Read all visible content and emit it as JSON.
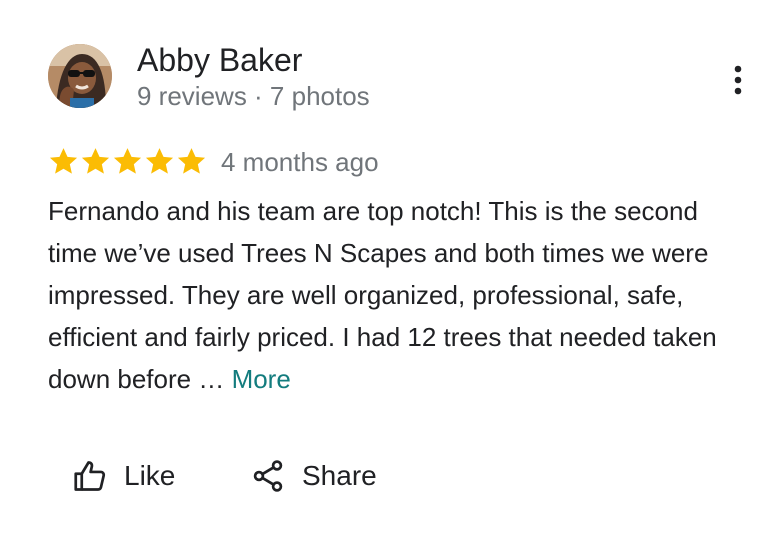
{
  "review": {
    "author": {
      "name": "Abby Baker",
      "meta": "9 reviews · 7 photos"
    },
    "rating": 5,
    "rating_max": 5,
    "time": "4 months ago",
    "text": "Fernando and his team are top notch! This is the second time we’ve used Trees N Scapes and both times we were impressed. They are well organized, professional, safe, efficient and fairly priced. I had 12 trees that needed taken down before … ",
    "more_label": "More"
  },
  "actions": {
    "like_label": "Like",
    "share_label": "Share"
  },
  "icons": {
    "avatar": "avatar-photo",
    "menu": "more-vert-icon",
    "star": "star-icon",
    "like": "thumb-up-icon",
    "share": "share-icon"
  },
  "colors": {
    "star": "#fbbc04",
    "link": "#137c7e",
    "text": "#202124",
    "secondary": "#70757a"
  }
}
